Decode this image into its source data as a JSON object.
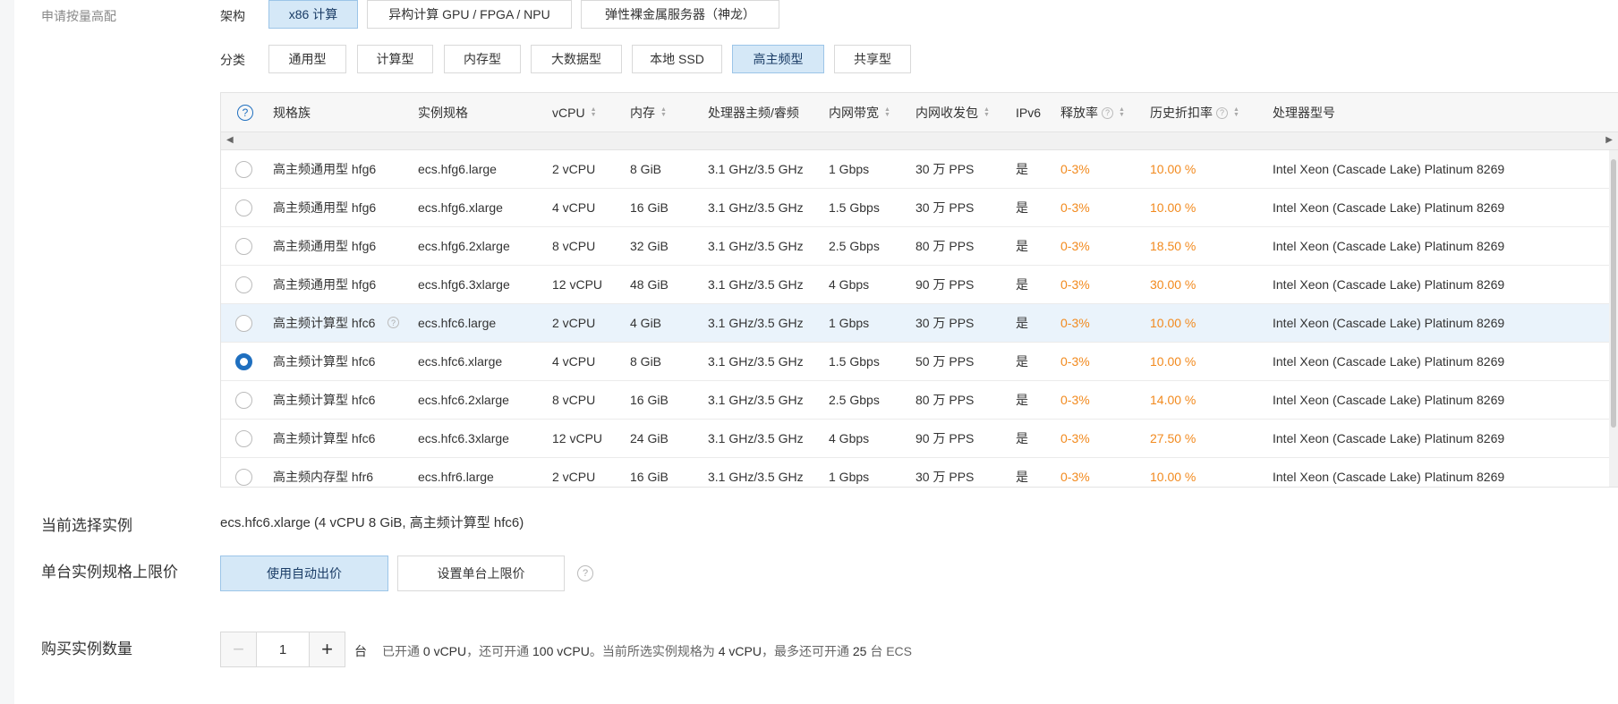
{
  "labels": {
    "apply_high": "申请按量高配",
    "arch": "架构",
    "category": "分类",
    "current_instance": "当前选择实例",
    "price_limit": "单台实例规格上限价",
    "quantity": "购买实例数量"
  },
  "arch_options": [
    {
      "label": "x86 计算",
      "active": true
    },
    {
      "label": "异构计算 GPU / FPGA / NPU",
      "active": false
    },
    {
      "label": "弹性裸金属服务器（神龙）",
      "active": false
    }
  ],
  "category_options": [
    {
      "label": "通用型",
      "active": false
    },
    {
      "label": "计算型",
      "active": false
    },
    {
      "label": "内存型",
      "active": false
    },
    {
      "label": "大数据型",
      "active": false
    },
    {
      "label": "本地 SSD",
      "active": false
    },
    {
      "label": "高主频型",
      "active": true
    },
    {
      "label": "共享型",
      "active": false
    }
  ],
  "table": {
    "help_icon": "?",
    "headers": {
      "family": "规格族",
      "spec": "实例规格",
      "vcpu": "vCPU",
      "mem": "内存",
      "freq": "处理器主频/睿频",
      "bw": "内网带宽",
      "pps": "内网收发包",
      "ipv6": "IPv6",
      "release": "释放率",
      "discount": "历史折扣率",
      "cpu_model": "处理器型号"
    },
    "rows": [
      {
        "family": "高主频通用型 hfg6",
        "spec": "ecs.hfg6.large",
        "vcpu": "2 vCPU",
        "mem": "8 GiB",
        "freq": "3.1 GHz/3.5 GHz",
        "bw": "1 Gbps",
        "pps": "30 万 PPS",
        "ipv6": "是",
        "release": "0-3%",
        "discount": "10.00 %",
        "cpu_model": "Intel Xeon (Cascade Lake) Platinum 8269",
        "checked": false,
        "hover": false
      },
      {
        "family": "高主频通用型 hfg6",
        "spec": "ecs.hfg6.xlarge",
        "vcpu": "4 vCPU",
        "mem": "16 GiB",
        "freq": "3.1 GHz/3.5 GHz",
        "bw": "1.5 Gbps",
        "pps": "30 万 PPS",
        "ipv6": "是",
        "release": "0-3%",
        "discount": "10.00 %",
        "cpu_model": "Intel Xeon (Cascade Lake) Platinum 8269",
        "checked": false,
        "hover": false
      },
      {
        "family": "高主频通用型 hfg6",
        "spec": "ecs.hfg6.2xlarge",
        "vcpu": "8 vCPU",
        "mem": "32 GiB",
        "freq": "3.1 GHz/3.5 GHz",
        "bw": "2.5 Gbps",
        "pps": "80 万 PPS",
        "ipv6": "是",
        "release": "0-3%",
        "discount": "18.50 %",
        "cpu_model": "Intel Xeon (Cascade Lake) Platinum 8269",
        "checked": false,
        "hover": false
      },
      {
        "family": "高主频通用型 hfg6",
        "spec": "ecs.hfg6.3xlarge",
        "vcpu": "12 vCPU",
        "mem": "48 GiB",
        "freq": "3.1 GHz/3.5 GHz",
        "bw": "4 Gbps",
        "pps": "90 万 PPS",
        "ipv6": "是",
        "release": "0-3%",
        "discount": "30.00 %",
        "cpu_model": "Intel Xeon (Cascade Lake) Platinum 8269",
        "checked": false,
        "hover": false
      },
      {
        "family": "高主频计算型 hfc6",
        "spec": "ecs.hfc6.large",
        "vcpu": "2 vCPU",
        "mem": "4 GiB",
        "freq": "3.1 GHz/3.5 GHz",
        "bw": "1 Gbps",
        "pps": "30 万 PPS",
        "ipv6": "是",
        "release": "0-3%",
        "discount": "10.00 %",
        "cpu_model": "Intel Xeon (Cascade Lake) Platinum 8269",
        "checked": false,
        "hover": true
      },
      {
        "family": "高主频计算型 hfc6",
        "spec": "ecs.hfc6.xlarge",
        "vcpu": "4 vCPU",
        "mem": "8 GiB",
        "freq": "3.1 GHz/3.5 GHz",
        "bw": "1.5 Gbps",
        "pps": "50 万 PPS",
        "ipv6": "是",
        "release": "0-3%",
        "discount": "10.00 %",
        "cpu_model": "Intel Xeon (Cascade Lake) Platinum 8269",
        "checked": true,
        "hover": false
      },
      {
        "family": "高主频计算型 hfc6",
        "spec": "ecs.hfc6.2xlarge",
        "vcpu": "8 vCPU",
        "mem": "16 GiB",
        "freq": "3.1 GHz/3.5 GHz",
        "bw": "2.5 Gbps",
        "pps": "80 万 PPS",
        "ipv6": "是",
        "release": "0-3%",
        "discount": "14.00 %",
        "cpu_model": "Intel Xeon (Cascade Lake) Platinum 8269",
        "checked": false,
        "hover": false
      },
      {
        "family": "高主频计算型 hfc6",
        "spec": "ecs.hfc6.3xlarge",
        "vcpu": "12 vCPU",
        "mem": "24 GiB",
        "freq": "3.1 GHz/3.5 GHz",
        "bw": "4 Gbps",
        "pps": "90 万 PPS",
        "ipv6": "是",
        "release": "0-3%",
        "discount": "27.50 %",
        "cpu_model": "Intel Xeon (Cascade Lake) Platinum 8269",
        "checked": false,
        "hover": false
      },
      {
        "family": "高主频内存型 hfr6",
        "spec": "ecs.hfr6.large",
        "vcpu": "2 vCPU",
        "mem": "16 GiB",
        "freq": "3.1 GHz/3.5 GHz",
        "bw": "1 Gbps",
        "pps": "30 万 PPS",
        "ipv6": "是",
        "release": "0-3%",
        "discount": "10.00 %",
        "cpu_model": "Intel Xeon (Cascade Lake) Platinum 8269",
        "checked": false,
        "hover": false
      }
    ]
  },
  "current_instance_value": "ecs.hfc6.xlarge (4 vCPU 8 GiB, 高主频计算型 hfc6)",
  "price": {
    "auto_label": "使用自动出价",
    "set_limit_label": "设置单台上限价",
    "help": "?"
  },
  "quantity": {
    "minus": "−",
    "value": "1",
    "plus": "+",
    "unit": "台",
    "info_prefix": "已开通",
    "info_opened": "0 vCPU",
    "info_mid": "，还可开通",
    "info_available": "100 vCPU",
    "info_mid2": "。当前所选实例规格为",
    "info_spec": "4 vCPU",
    "info_mid3": "，最多还可开通",
    "info_max": "25",
    "info_suffix": "台 ECS"
  },
  "colors": {
    "accent": "#1f6fbf",
    "orange": "#f28a1e",
    "active_bg": "#d5e8f7"
  }
}
